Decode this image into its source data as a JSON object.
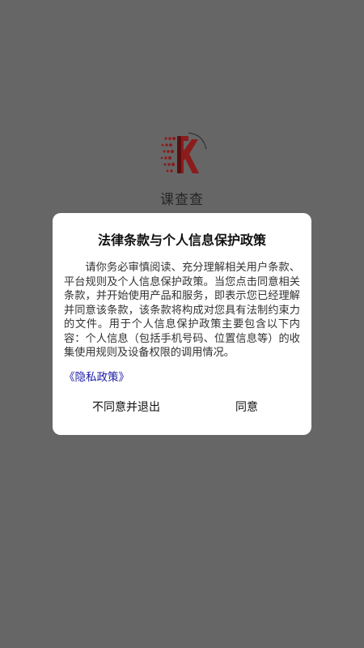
{
  "splash": {
    "app_name": "课查查",
    "logo_color": "#8b1c1c"
  },
  "dialog": {
    "title": "法律条款与个人信息保护政策",
    "body": "请你务必审慎阅读、充分理解相关用户条款、平台规则及个人信息保护政策。当您点击同意相关条款，并开始使用产品和服务，即表示您已经理解并同意该条款，该条款将构成对您具有法制约束力的文件。用于个人信息保护政策主要包含以下内容：个人信息（包括手机号码、位置信息等）的收集使用规则及设备权限的调用情况。",
    "privacy_link": "《隐私政策》",
    "decline_label": "不同意并退出",
    "agree_label": "同意"
  },
  "colors": {
    "overlay": "#666666",
    "dialog_bg": "#ffffff",
    "link": "#1a1aa6"
  }
}
